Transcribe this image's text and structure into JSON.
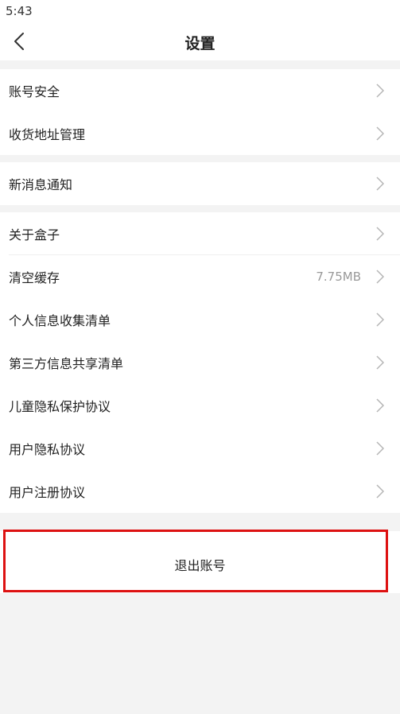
{
  "status_bar": {
    "time": "5:43"
  },
  "header": {
    "title": "设置",
    "back_icon": "chevron-left-icon"
  },
  "groups": [
    {
      "items": [
        {
          "label": "账号安全"
        },
        {
          "label": "收货地址管理"
        }
      ]
    },
    {
      "items": [
        {
          "label": "新消息通知"
        }
      ]
    },
    {
      "items": [
        {
          "label": "关于盒子"
        },
        {
          "label": "清空缓存",
          "value": "7.75MB"
        },
        {
          "label": "个人信息收集清单"
        },
        {
          "label": "第三方信息共享清单"
        },
        {
          "label": "儿童隐私保护协议"
        },
        {
          "label": "用户隐私协议"
        },
        {
          "label": "用户注册协议"
        }
      ]
    }
  ],
  "logout": {
    "label": "退出账号",
    "highlight_color": "#dd1111"
  },
  "colors": {
    "background": "#f3f3f3",
    "surface": "#ffffff",
    "chevron": "#b5b5b5"
  }
}
